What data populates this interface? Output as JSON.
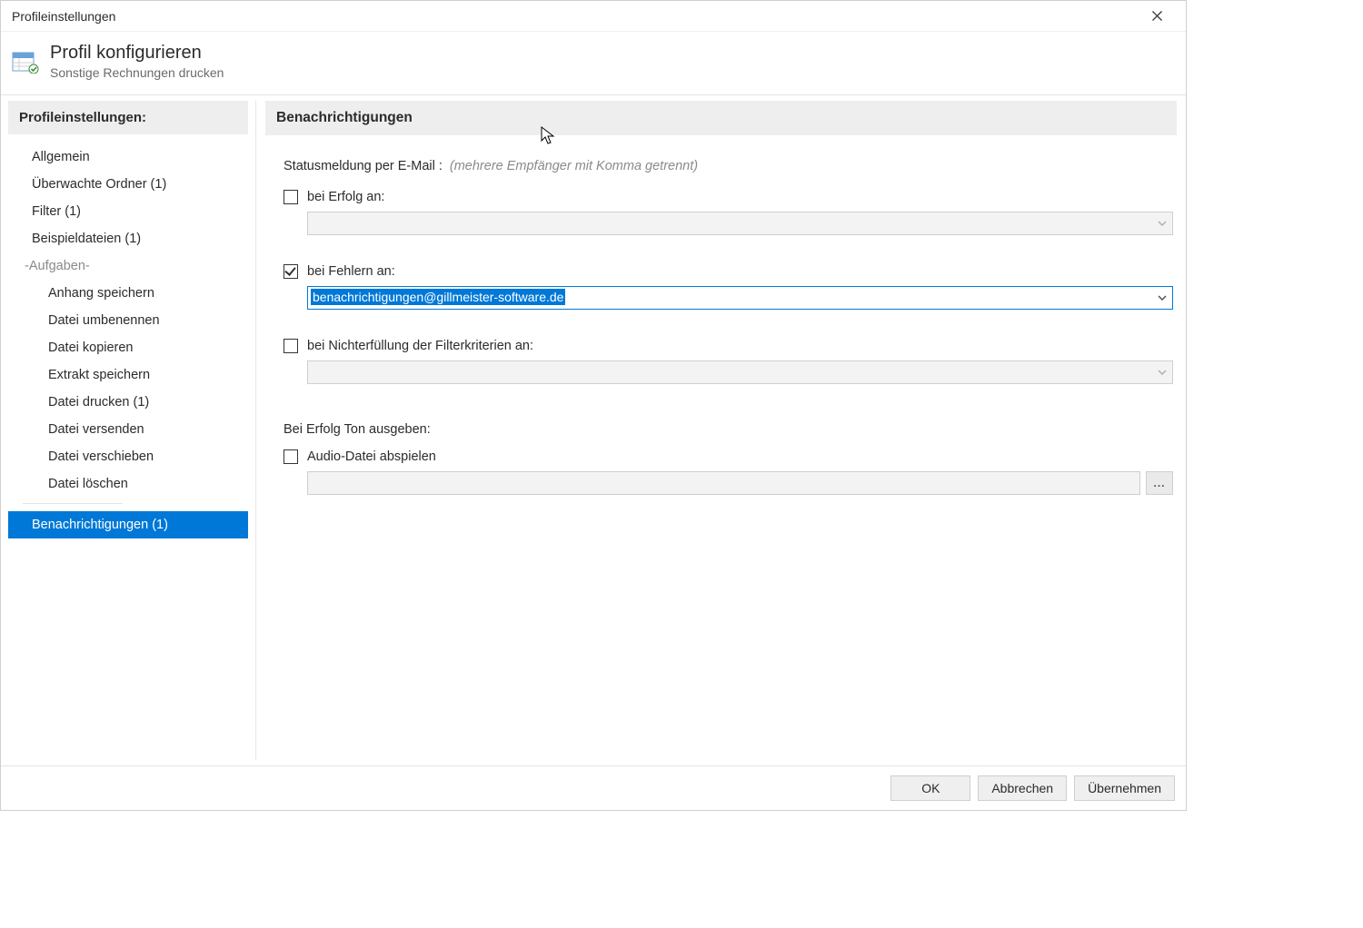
{
  "window": {
    "title": "Profileinstellungen"
  },
  "header": {
    "title": "Profil konfigurieren",
    "subtitle": "Sonstige Rechnungen drucken"
  },
  "sidebar": {
    "header": "Profileinstellungen:",
    "items": {
      "allgemein": "Allgemein",
      "ueberwachte": "Überwachte Ordner (1)",
      "filter": "Filter (1)",
      "beispieldateien": "Beispieldateien (1)"
    },
    "section": "-Aufgaben-",
    "tasks": {
      "anhang": "Anhang speichern",
      "umbenennen": "Datei umbenennen",
      "kopieren": "Datei kopieren",
      "extrakt": "Extrakt speichern",
      "drucken": "Datei drucken (1)",
      "versenden": "Datei versenden",
      "verschieben": "Datei verschieben",
      "loeschen": "Datei löschen"
    },
    "selected": "Benachrichtigungen (1)"
  },
  "content": {
    "header": "Benachrichtigungen",
    "email": {
      "label": "Statusmeldung per E-Mail :",
      "hint": "(mehrere Empfänger mit Komma getrennt)",
      "success": {
        "label": "bei Erfolg an:",
        "checked": false,
        "value": ""
      },
      "error": {
        "label": "bei Fehlern an:",
        "checked": true,
        "value": "benachrichtigungen@gillmeister-software.de"
      },
      "filter": {
        "label": "bei Nichterfüllung der Filterkriterien an:",
        "checked": false,
        "value": ""
      }
    },
    "sound": {
      "label": "Bei Erfolg Ton ausgeben:",
      "play": {
        "label": "Audio-Datei abspielen",
        "checked": false,
        "value": ""
      },
      "browse": "..."
    }
  },
  "footer": {
    "ok": "OK",
    "cancel": "Abbrechen",
    "apply": "Übernehmen"
  }
}
